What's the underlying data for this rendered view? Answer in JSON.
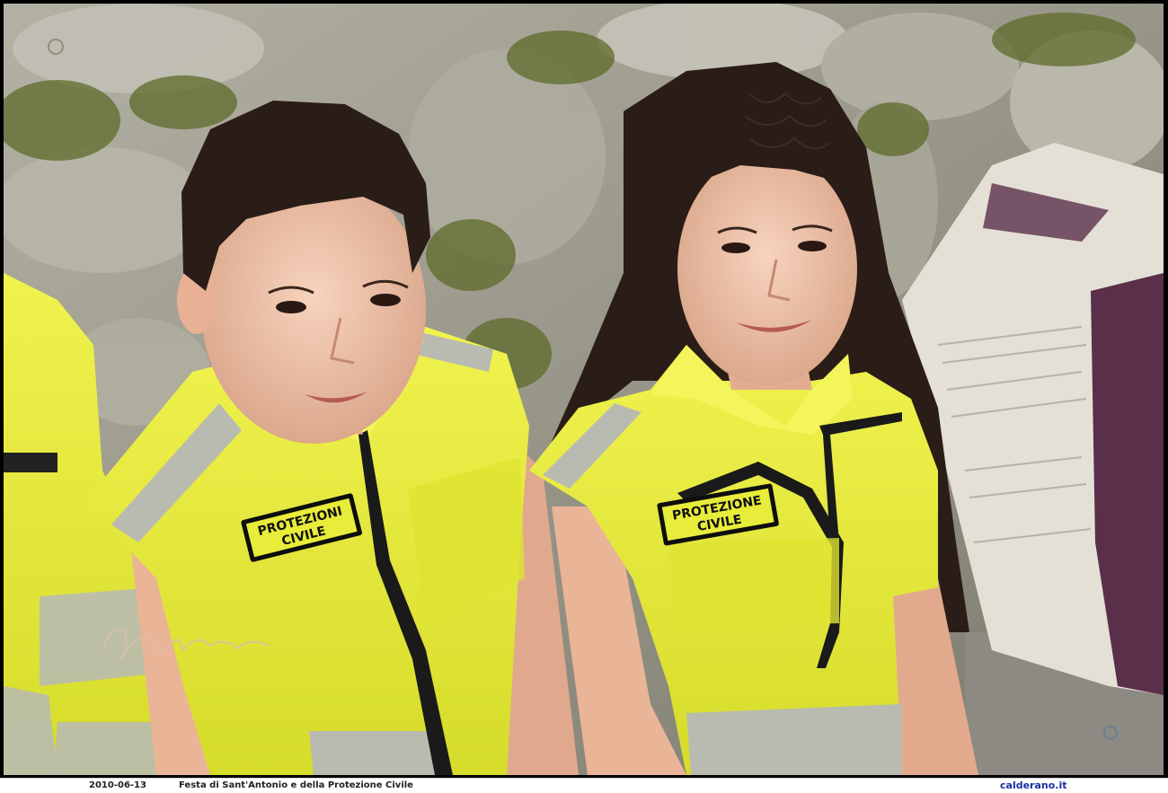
{
  "caption": {
    "date": "2010-06-13",
    "title": "Festa di Sant'Antonio e della Protezione Civile",
    "site": "calderano.it"
  },
  "photo": {
    "boy_badge": {
      "line1": "PROTEZIONI",
      "line2": "CIVILE"
    },
    "girl_badge": {
      "line1": "PROTEZIONE",
      "line2": "CIVILE"
    },
    "colors": {
      "vest_yellow": "#e8ec3a",
      "vest_shade": "#c9cf2a",
      "reflective": "#b9bbb0",
      "rock": "#9c9a8e",
      "moss": "#5e6b2a",
      "skin": "#f1c6ad",
      "hair": "#2a1c16",
      "sack": "#e4e0d6",
      "sack_purple": "#5a2f4a"
    }
  }
}
